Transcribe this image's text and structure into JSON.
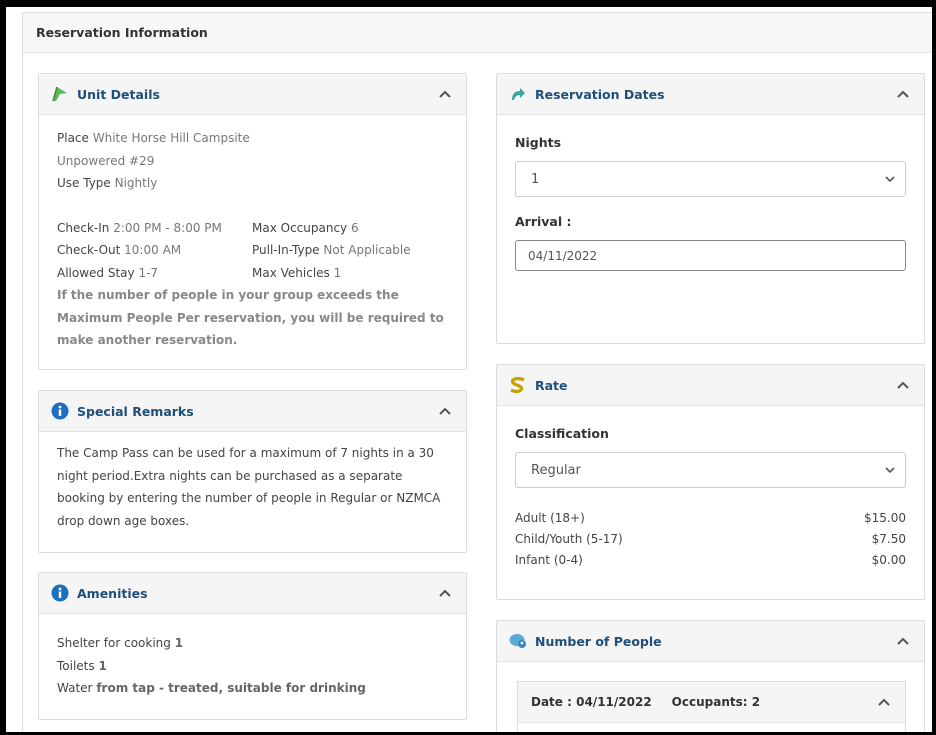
{
  "page": {
    "title": "Reservation Information"
  },
  "unit_details": {
    "title": "Unit Details",
    "place_label": "Place",
    "place_value": "White Horse Hill Campsite",
    "site_name": "Unpowered #29",
    "use_type_label": "Use Type",
    "use_type_value": "Nightly",
    "checkin_label": "Check-In",
    "checkin_value": "2:00 PM - 8:00 PM",
    "max_occupancy_label": "Max Occupancy",
    "max_occupancy_value": "6",
    "checkout_label": "Check-Out",
    "checkout_value": "10:00 AM",
    "pull_in_label": "Pull-In-Type",
    "pull_in_value": "Not Applicable",
    "allowed_stay_label": "Allowed Stay",
    "allowed_stay_value": "1-7",
    "max_vehicles_label": "Max Vehicles",
    "max_vehicles_value": "1",
    "notice": "If the number of people in your group exceeds the Maximum People Per reservation, you will be required to make another reservation."
  },
  "special_remarks": {
    "title": "Special Remarks",
    "text": "The Camp Pass can be used for a maximum of 7 nights in a 30 night period.Extra nights can be purchased as a separate booking by entering the number of people in Regular or NZMCA drop down age boxes."
  },
  "amenities": {
    "title": "Amenities",
    "items": [
      {
        "name": "Shelter for cooking",
        "value": "1"
      },
      {
        "name": "Toilets",
        "value": "1"
      },
      {
        "name": "Water",
        "value": "from tap - treated, suitable for drinking"
      }
    ]
  },
  "reservation_dates": {
    "title": "Reservation Dates",
    "nights_label": "Nights",
    "nights_value": "1",
    "arrival_label": "Arrival :",
    "arrival_value": "04/11/2022"
  },
  "rate": {
    "title": "Rate",
    "classification_label": "Classification",
    "classification_value": "Regular",
    "rows": [
      {
        "label": "Adult (18+)",
        "price": "$15.00"
      },
      {
        "label": "Child/Youth (5-17)",
        "price": "$7.50"
      },
      {
        "label": "Infant (0-4)",
        "price": "$0.00"
      }
    ]
  },
  "number_of_people": {
    "title": "Number of People",
    "date_label": "Date :",
    "date_value": "04/11/2022",
    "occupants_label": "Occupants:",
    "occupants_value": "2"
  },
  "colors": {
    "title_blue": "#1f4e79",
    "accent_green": "#5cb85c"
  }
}
